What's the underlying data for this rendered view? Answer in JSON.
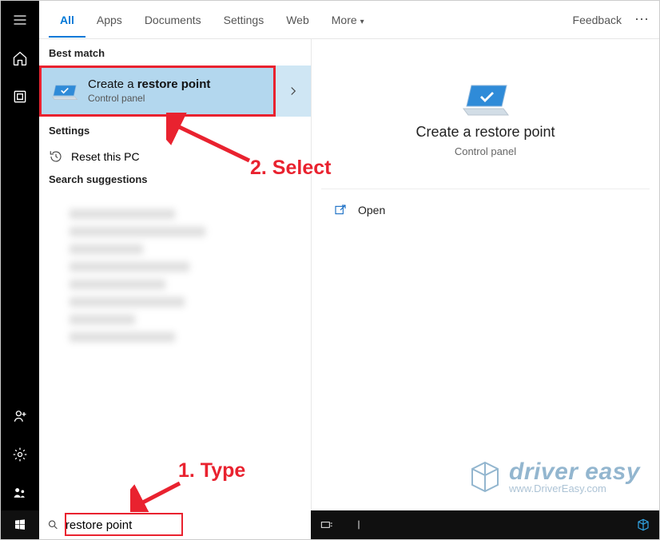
{
  "tabs": {
    "all": "All",
    "apps": "Apps",
    "documents": "Documents",
    "settings": "Settings",
    "web": "Web",
    "more": "More"
  },
  "header": {
    "feedback": "Feedback"
  },
  "sections": {
    "best_match": "Best match",
    "settings": "Settings",
    "search_suggestions": "Search suggestions"
  },
  "result": {
    "title_pre": "Create a ",
    "title_bold": "restore point",
    "subtitle": "Control panel"
  },
  "settings_item": {
    "reset": "Reset this PC"
  },
  "preview": {
    "title": "Create a restore point",
    "subtitle": "Control panel",
    "open": "Open"
  },
  "search": {
    "value": "restore point"
  },
  "annotations": {
    "type": "1. Type",
    "select": "2. Select"
  },
  "watermark": {
    "brand": "driver easy",
    "url": "www.DriverEasy.com"
  }
}
